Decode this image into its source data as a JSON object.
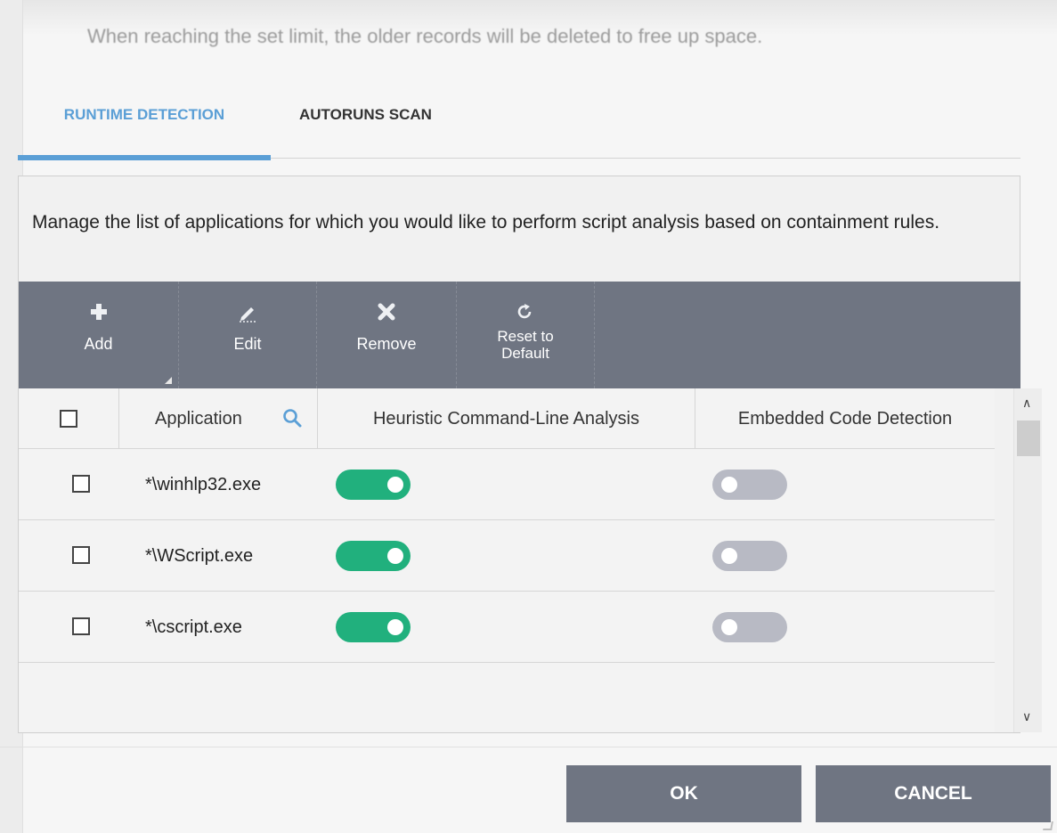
{
  "top_note": "When reaching the set limit, the older records will be deleted to free up space.",
  "tabs": [
    {
      "label": "RUNTIME DETECTION",
      "active": true
    },
    {
      "label": "AUTORUNS SCAN",
      "active": false
    }
  ],
  "description": "Manage the list of applications for which you would like to perform script analysis based on containment rules.",
  "toolbar": {
    "add": {
      "label": "Add",
      "icon": "plus-icon"
    },
    "edit": {
      "label": "Edit",
      "icon": "pencil-icon"
    },
    "remove": {
      "label": "Remove",
      "icon": "x-icon"
    },
    "reset": {
      "label": "Reset to Default",
      "line1": "Reset to",
      "line2": "Default",
      "icon": "reset-icon"
    }
  },
  "table": {
    "columns": [
      "Application",
      "Heuristic Command-Line Analysis",
      "Embedded Code Detection"
    ],
    "rows": [
      {
        "application": "*\\winhlp32.exe",
        "heuristic": true,
        "embedded": false
      },
      {
        "application": "*\\WScript.exe",
        "heuristic": true,
        "embedded": false
      },
      {
        "application": "*\\cscript.exe",
        "heuristic": true,
        "embedded": false
      }
    ]
  },
  "buttons": {
    "ok": "OK",
    "cancel": "CANCEL"
  },
  "colors": {
    "accent": "#5b9fd6",
    "toolbar": "#6f7582",
    "toggle_on": "#21b07d",
    "toggle_off": "#b8bac4"
  }
}
